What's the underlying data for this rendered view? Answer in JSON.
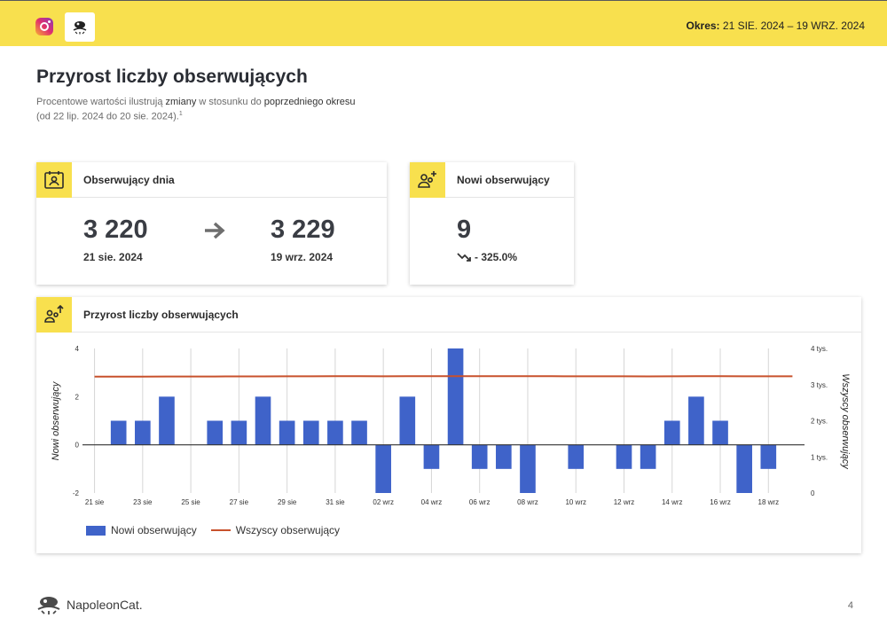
{
  "header": {
    "period_label": "Okres:",
    "period_value": "21 SIE. 2024 – 19 WRZ. 2024"
  },
  "page": {
    "title": "Przyrost liczby obserwujących",
    "subtitle_parts": [
      "Procentowe wartości ilustrują ",
      "zmiany",
      " w stosunku do ",
      "poprzedniego okresu",
      " (od 22 lip. 2024 do 20 sie. 2024).",
      "1"
    ]
  },
  "daily_card": {
    "title": "Obserwujący dnia",
    "start_value": "3 220",
    "start_date": "21 sie. 2024",
    "end_value": "3 229",
    "end_date": "19 wrz. 2024"
  },
  "new_card": {
    "title": "Nowi obserwujący",
    "value": "9",
    "change": "- 325.0%"
  },
  "chart_card": {
    "title": "Przyrost liczby obserwujących"
  },
  "footer": {
    "brand": "NapoleonCat.",
    "page_number": "4"
  },
  "chart_data": {
    "type": "bar",
    "title": "Przyrost liczby obserwujących",
    "ylabel": "Nowi obserwujący",
    "y2label": "Wszyscy obserwujący",
    "ylim": [
      -2,
      4
    ],
    "y2lim": [
      0,
      4000
    ],
    "yticks": [
      "4",
      "2",
      "0",
      "-2"
    ],
    "y2ticks": [
      "4 tys.",
      "3 tys.",
      "2 tys.",
      "1 tys.",
      "0"
    ],
    "categories": [
      "21 sie",
      "22 sie",
      "23 sie",
      "24 sie",
      "25 sie",
      "26 sie",
      "27 sie",
      "28 sie",
      "29 sie",
      "30 sie",
      "31 sie",
      "01 wrz",
      "02 wrz",
      "03 wrz",
      "04 wrz",
      "05 wrz",
      "06 wrz",
      "07 wrz",
      "08 wrz",
      "09 wrz",
      "10 wrz",
      "11 wrz",
      "12 wrz",
      "13 wrz",
      "14 wrz",
      "15 wrz",
      "16 wrz",
      "17 wrz",
      "18 wrz",
      "19 wrz"
    ],
    "xtick_labels": [
      "21 sie",
      "23 sie",
      "25 sie",
      "27 sie",
      "29 sie",
      "31 sie",
      "02 wrz",
      "04 wrz",
      "06 wrz",
      "08 wrz",
      "10 wrz",
      "12 wrz",
      "14 wrz",
      "16 wrz",
      "18 wrz"
    ],
    "grid": true,
    "legend_position": "bottom-left",
    "series": [
      {
        "name": "Nowi obserwujący",
        "type": "bar",
        "axis": "left",
        "color": "#3f63c9",
        "values": [
          0,
          1,
          1,
          2,
          0,
          1,
          1,
          2,
          1,
          1,
          1,
          1,
          -2,
          2,
          -1,
          4,
          -1,
          -1,
          -2,
          0,
          -1,
          0,
          -1,
          -1,
          1,
          2,
          1,
          -2,
          -1,
          0
        ]
      },
      {
        "name": "Wszyscy obserwujący",
        "type": "line",
        "axis": "right",
        "color": "#c8512c",
        "values": [
          3220,
          3221,
          3222,
          3224,
          3224,
          3225,
          3226,
          3228,
          3229,
          3230,
          3231,
          3232,
          3230,
          3232,
          3231,
          3235,
          3234,
          3233,
          3231,
          3231,
          3230,
          3230,
          3229,
          3228,
          3229,
          3231,
          3232,
          3230,
          3229,
          3229
        ]
      }
    ]
  }
}
